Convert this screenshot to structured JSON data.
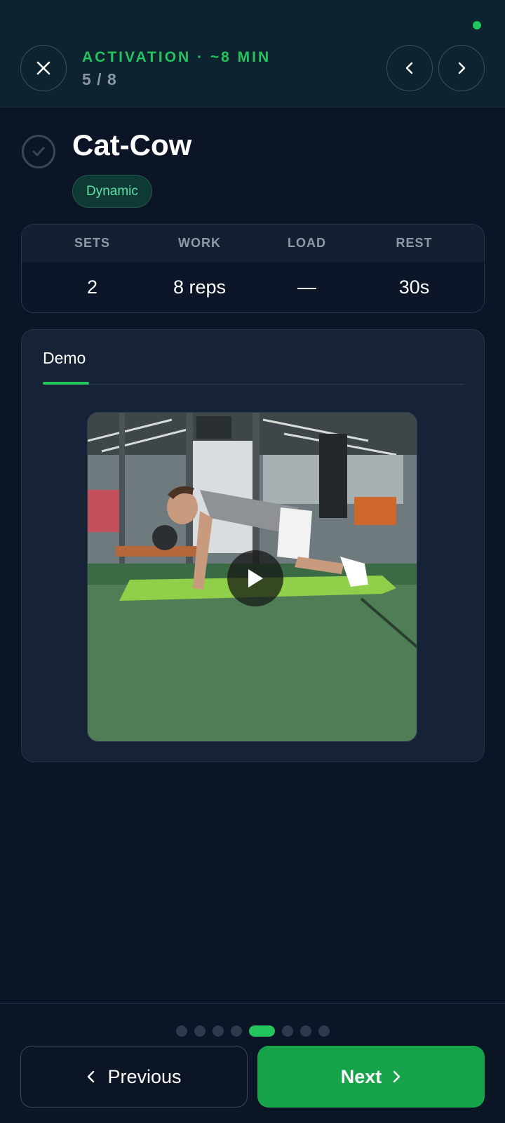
{
  "header": {
    "section_label": "ACTIVATION · ~8 MIN",
    "progress": "5 / 8",
    "status_color": "#22c55e",
    "icons": {
      "close": "close-icon",
      "prev": "chevron-left-icon",
      "next": "chevron-right-icon"
    }
  },
  "exercise": {
    "title": "Cat-Cow",
    "tag": "Dynamic",
    "completed": false
  },
  "stats": {
    "headers": [
      "SETS",
      "WORK",
      "LOAD",
      "REST"
    ],
    "values": [
      "2",
      "8 reps",
      "—",
      "30s"
    ]
  },
  "demo": {
    "tab_label": "Demo",
    "video_icon": "play-icon"
  },
  "pagination": {
    "total": 8,
    "current": 5
  },
  "buttons": {
    "previous": "Previous",
    "next": "Next"
  },
  "colors": {
    "accent": "#22c55e",
    "background": "#0b1526",
    "next_button": "#16a34a"
  }
}
